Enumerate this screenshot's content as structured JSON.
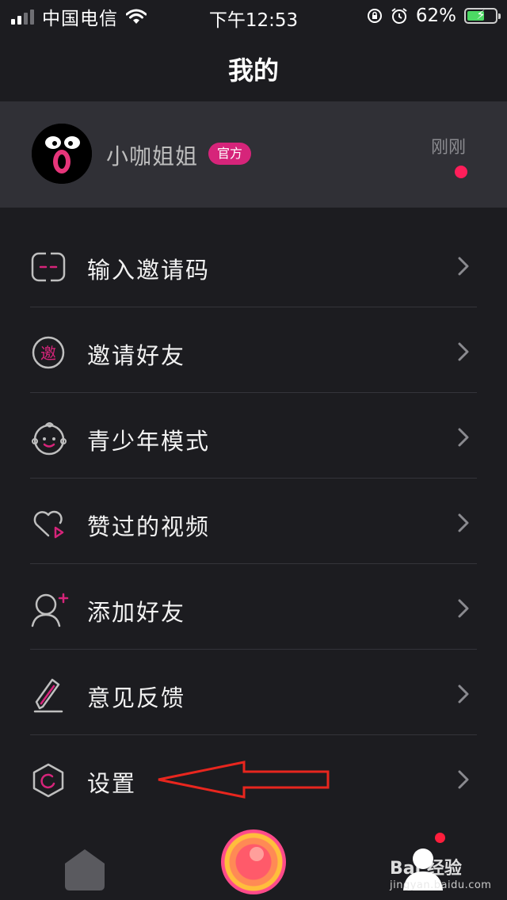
{
  "status_bar": {
    "carrier": "中国电信",
    "time": "下午12:53",
    "battery_percent": "62%",
    "battery_level": 0.62,
    "icons": [
      "signal-icon",
      "wifi-icon",
      "rotation-lock-icon",
      "alarm-icon",
      "battery-charging-icon"
    ]
  },
  "header": {
    "title": "我的"
  },
  "profile": {
    "name": "小咖姐姐",
    "badge": "官方",
    "time": "刚刚",
    "unread": true
  },
  "menu": {
    "items": [
      {
        "label": "输入邀请码",
        "icon": "invite-code-icon"
      },
      {
        "label": "邀请好友",
        "icon": "invite-badge-icon",
        "icon_text": "邀"
      },
      {
        "label": "青少年模式",
        "icon": "child-face-icon"
      },
      {
        "label": "赞过的视频",
        "icon": "heart-play-icon"
      },
      {
        "label": "添加好友",
        "icon": "add-friend-icon"
      },
      {
        "label": "意见反馈",
        "icon": "pencil-icon"
      },
      {
        "label": "设置",
        "icon": "settings-hexagon-icon"
      }
    ]
  },
  "bottom_bar": {
    "tabs": [
      "home-tab",
      "record-button",
      "profile-tab"
    ],
    "profile_has_notification": true
  },
  "watermark": {
    "brand": "Bai 经验",
    "sub": "jingyan.baidu.com"
  },
  "colors": {
    "background": "#1c1c20",
    "card": "#303036",
    "accent_pink": "#d6247a",
    "notification_red": "#ff1e5a",
    "annotation_red": "#e8261e",
    "icon_gray": "#bfbfbf"
  }
}
